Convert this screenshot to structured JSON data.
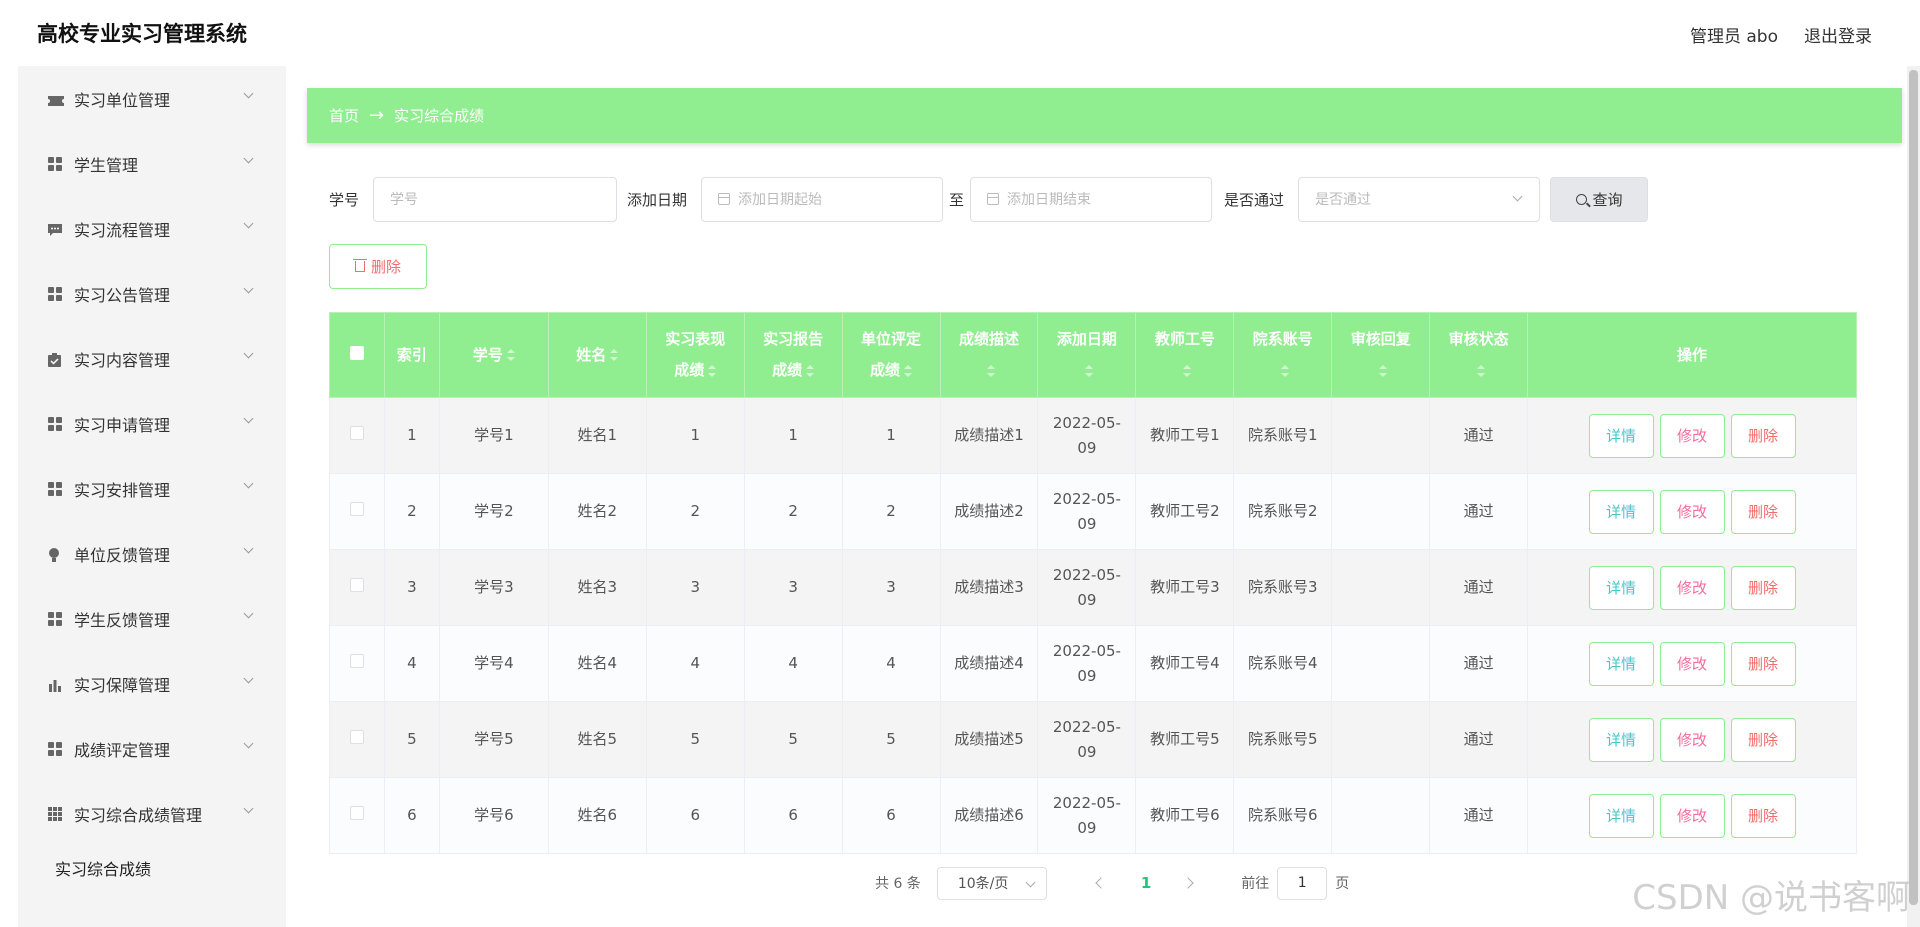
{
  "header": {
    "title": "高校专业实习管理系统",
    "user": "管理员 abo",
    "logout": "退出登录"
  },
  "sidebar": {
    "items": [
      {
        "label": "实习单位管理",
        "icon": "ticket-icon"
      },
      {
        "label": "学生管理",
        "icon": "grid-icon"
      },
      {
        "label": "实习流程管理",
        "icon": "chat-icon"
      },
      {
        "label": "实习公告管理",
        "icon": "grid-icon"
      },
      {
        "label": "实习内容管理",
        "icon": "clipboard-icon"
      },
      {
        "label": "实习申请管理",
        "icon": "grid-icon"
      },
      {
        "label": "实习安排管理",
        "icon": "grid-icon"
      },
      {
        "label": "单位反馈管理",
        "icon": "bulb-icon"
      },
      {
        "label": "学生反馈管理",
        "icon": "grid-icon"
      },
      {
        "label": "实习保障管理",
        "icon": "bar-chart-icon"
      },
      {
        "label": "成绩评定管理",
        "icon": "grid-icon"
      },
      {
        "label": "实习综合成绩管理",
        "icon": "grid9-icon"
      }
    ],
    "sub_item": "实习综合成绩"
  },
  "breadcrumb": {
    "home": "首页",
    "arrow": "→",
    "current": "实习综合成绩"
  },
  "search": {
    "xuehao_label": "学号",
    "xuehao_placeholder": "学号",
    "date_label": "添加日期",
    "date_start_placeholder": "添加日期起始",
    "date_sep": "至",
    "date_end_placeholder": "添加日期结束",
    "pass_label": "是否通过",
    "pass_placeholder": "是否通过",
    "query_button": "查询"
  },
  "toolbar": {
    "delete_button": "删除"
  },
  "table": {
    "columns": [
      "索引",
      "学号",
      "姓名",
      "实习表现成绩",
      "实习报告成绩",
      "单位评定成绩",
      "成绩描述",
      "添加日期",
      "教师工号",
      "院系账号",
      "审核回复",
      "审核状态",
      "操作"
    ],
    "col_parts": {
      "c3a": "实习表现",
      "c3b": "成绩",
      "c4a": "实习报告",
      "c4b": "成绩",
      "c5a": "单位评定",
      "c5b": "成绩"
    },
    "rows": [
      {
        "index": "1",
        "xuehao": "学号1",
        "name": "姓名1",
        "biaoxian": "1",
        "baogao": "1",
        "danwei": "1",
        "miaoshu": "成绩描述1",
        "date_a": "2022-05-",
        "date_b": "09",
        "teacher": "教师工号1",
        "yuanxi": "院系账号1",
        "reply": "",
        "status": "通过"
      },
      {
        "index": "2",
        "xuehao": "学号2",
        "name": "姓名2",
        "biaoxian": "2",
        "baogao": "2",
        "danwei": "2",
        "miaoshu": "成绩描述2",
        "date_a": "2022-05-",
        "date_b": "09",
        "teacher": "教师工号2",
        "yuanxi": "院系账号2",
        "reply": "",
        "status": "通过"
      },
      {
        "index": "3",
        "xuehao": "学号3",
        "name": "姓名3",
        "biaoxian": "3",
        "baogao": "3",
        "danwei": "3",
        "miaoshu": "成绩描述3",
        "date_a": "2022-05-",
        "date_b": "09",
        "teacher": "教师工号3",
        "yuanxi": "院系账号3",
        "reply": "",
        "status": "通过"
      },
      {
        "index": "4",
        "xuehao": "学号4",
        "name": "姓名4",
        "biaoxian": "4",
        "baogao": "4",
        "danwei": "4",
        "miaoshu": "成绩描述4",
        "date_a": "2022-05-",
        "date_b": "09",
        "teacher": "教师工号4",
        "yuanxi": "院系账号4",
        "reply": "",
        "status": "通过"
      },
      {
        "index": "5",
        "xuehao": "学号5",
        "name": "姓名5",
        "biaoxian": "5",
        "baogao": "5",
        "danwei": "5",
        "miaoshu": "成绩描述5",
        "date_a": "2022-05-",
        "date_b": "09",
        "teacher": "教师工号5",
        "yuanxi": "院系账号5",
        "reply": "",
        "status": "通过"
      },
      {
        "index": "6",
        "xuehao": "学号6",
        "name": "姓名6",
        "biaoxian": "6",
        "baogao": "6",
        "danwei": "6",
        "miaoshu": "成绩描述6",
        "date_a": "2022-05-",
        "date_b": "09",
        "teacher": "教师工号6",
        "yuanxi": "院系账号6",
        "reply": "",
        "status": "通过"
      }
    ],
    "actions": {
      "detail": "详情",
      "edit": "修改",
      "delete": "删除"
    }
  },
  "pagination": {
    "total": "共 6 条",
    "page_size": "10条/页",
    "current_page": "1",
    "goto_label": "前往",
    "goto_value": "1",
    "goto_suffix": "页"
  },
  "watermark": "CSDN @说书客啊",
  "colors": {
    "accent_green": "#90ee90",
    "detail_text": "#4cc4cc",
    "edit_text": "#f56c9c",
    "delete_text": "#f56c6c",
    "active_page": "#27c27c"
  }
}
